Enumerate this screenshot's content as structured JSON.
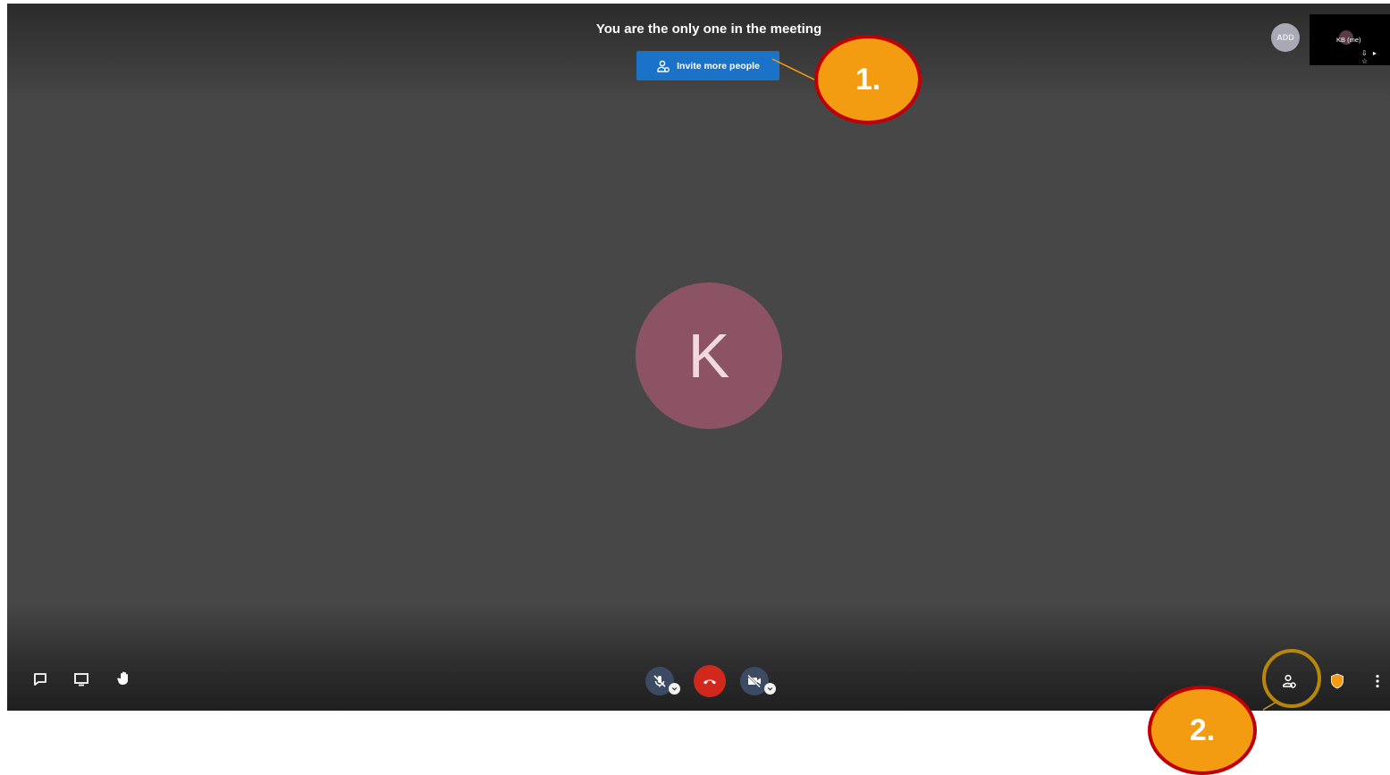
{
  "meeting": {
    "notice": "You are the only one in the meeting",
    "invite_label": "Invite more people",
    "participant_initial": "K",
    "small_avatar_text": "ADD",
    "self_view_name": "KB (me)"
  },
  "annotations": {
    "step1": "1.",
    "step2": "2."
  },
  "toolbar": {
    "left": [
      "chat-icon",
      "screen-share-icon",
      "raise-hand-icon"
    ],
    "center": [
      "mute-microphone-icon",
      "hang-up-icon",
      "camera-off-icon"
    ],
    "right": [
      "invite-people-icon",
      "security-shield-icon",
      "more-options-icon"
    ]
  },
  "colors": {
    "stage_bg": "#474747",
    "invite_button": "#1a73c8",
    "participant_avatar": "#8c5364",
    "hangup": "#d1281d",
    "callout_fill": "#f39c12",
    "callout_border": "#c00000",
    "highlight_ring": "#b8860b",
    "shield": "#f39c12"
  }
}
